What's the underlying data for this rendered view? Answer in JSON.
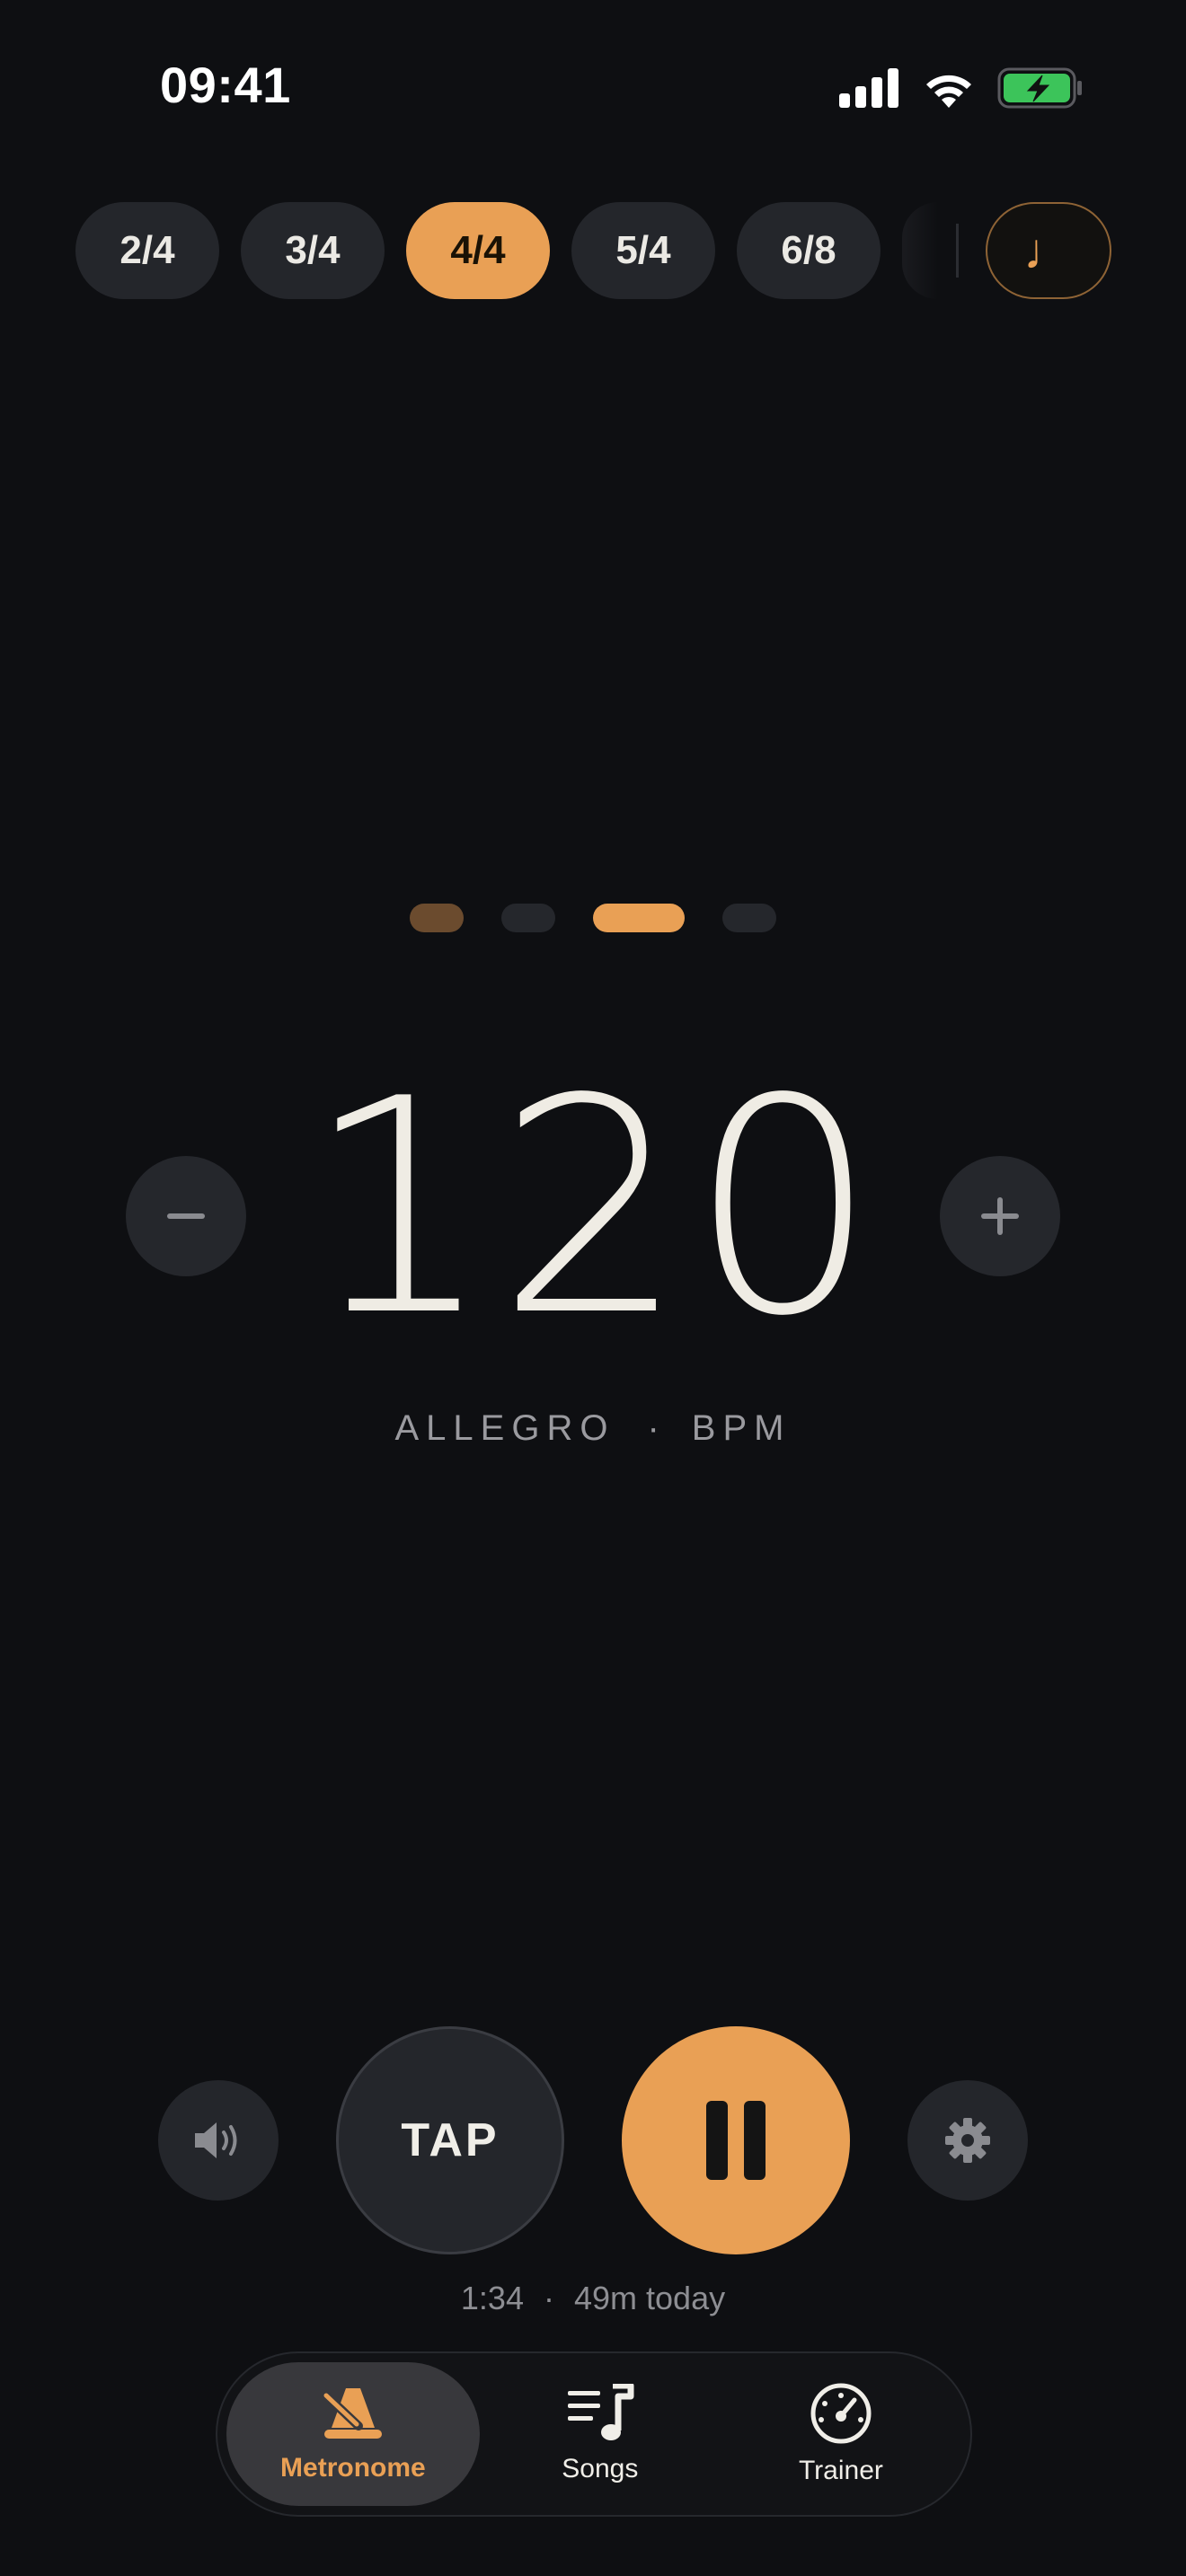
{
  "status_bar": {
    "time": "09:41",
    "icons": [
      "cellular-signal-icon",
      "wifi-icon",
      "battery-charging-icon"
    ]
  },
  "time_signatures": {
    "items": [
      "2/4",
      "3/4",
      "4/4",
      "5/4",
      "6/8"
    ],
    "selected": "4/4",
    "subdivision_icon": "quarter-note-icon",
    "subdivision_glyph": "♩"
  },
  "beats": {
    "count": 4,
    "current": 3,
    "accent_dim": 1
  },
  "tempo": {
    "bpm": "120",
    "marking": "ALLEGRO",
    "separator": "·",
    "unit": "BPM"
  },
  "controls": {
    "tap_label": "TAP",
    "state": "playing",
    "sound_icon": "speaker-icon",
    "settings_icon": "gear-icon"
  },
  "session": {
    "elapsed": "1:34",
    "separator": "·",
    "today": "49m today"
  },
  "tabbar": {
    "items": [
      {
        "label": "Metronome",
        "icon": "metronome-icon"
      },
      {
        "label": "Songs",
        "icon": "song-list-icon"
      },
      {
        "label": "Trainer",
        "icon": "speedometer-icon"
      }
    ],
    "selected": "Metronome"
  },
  "colors": {
    "accent": "#e9a055",
    "background": "#0e0f12",
    "surface": "#24262b",
    "battery": "#3cc45a"
  }
}
